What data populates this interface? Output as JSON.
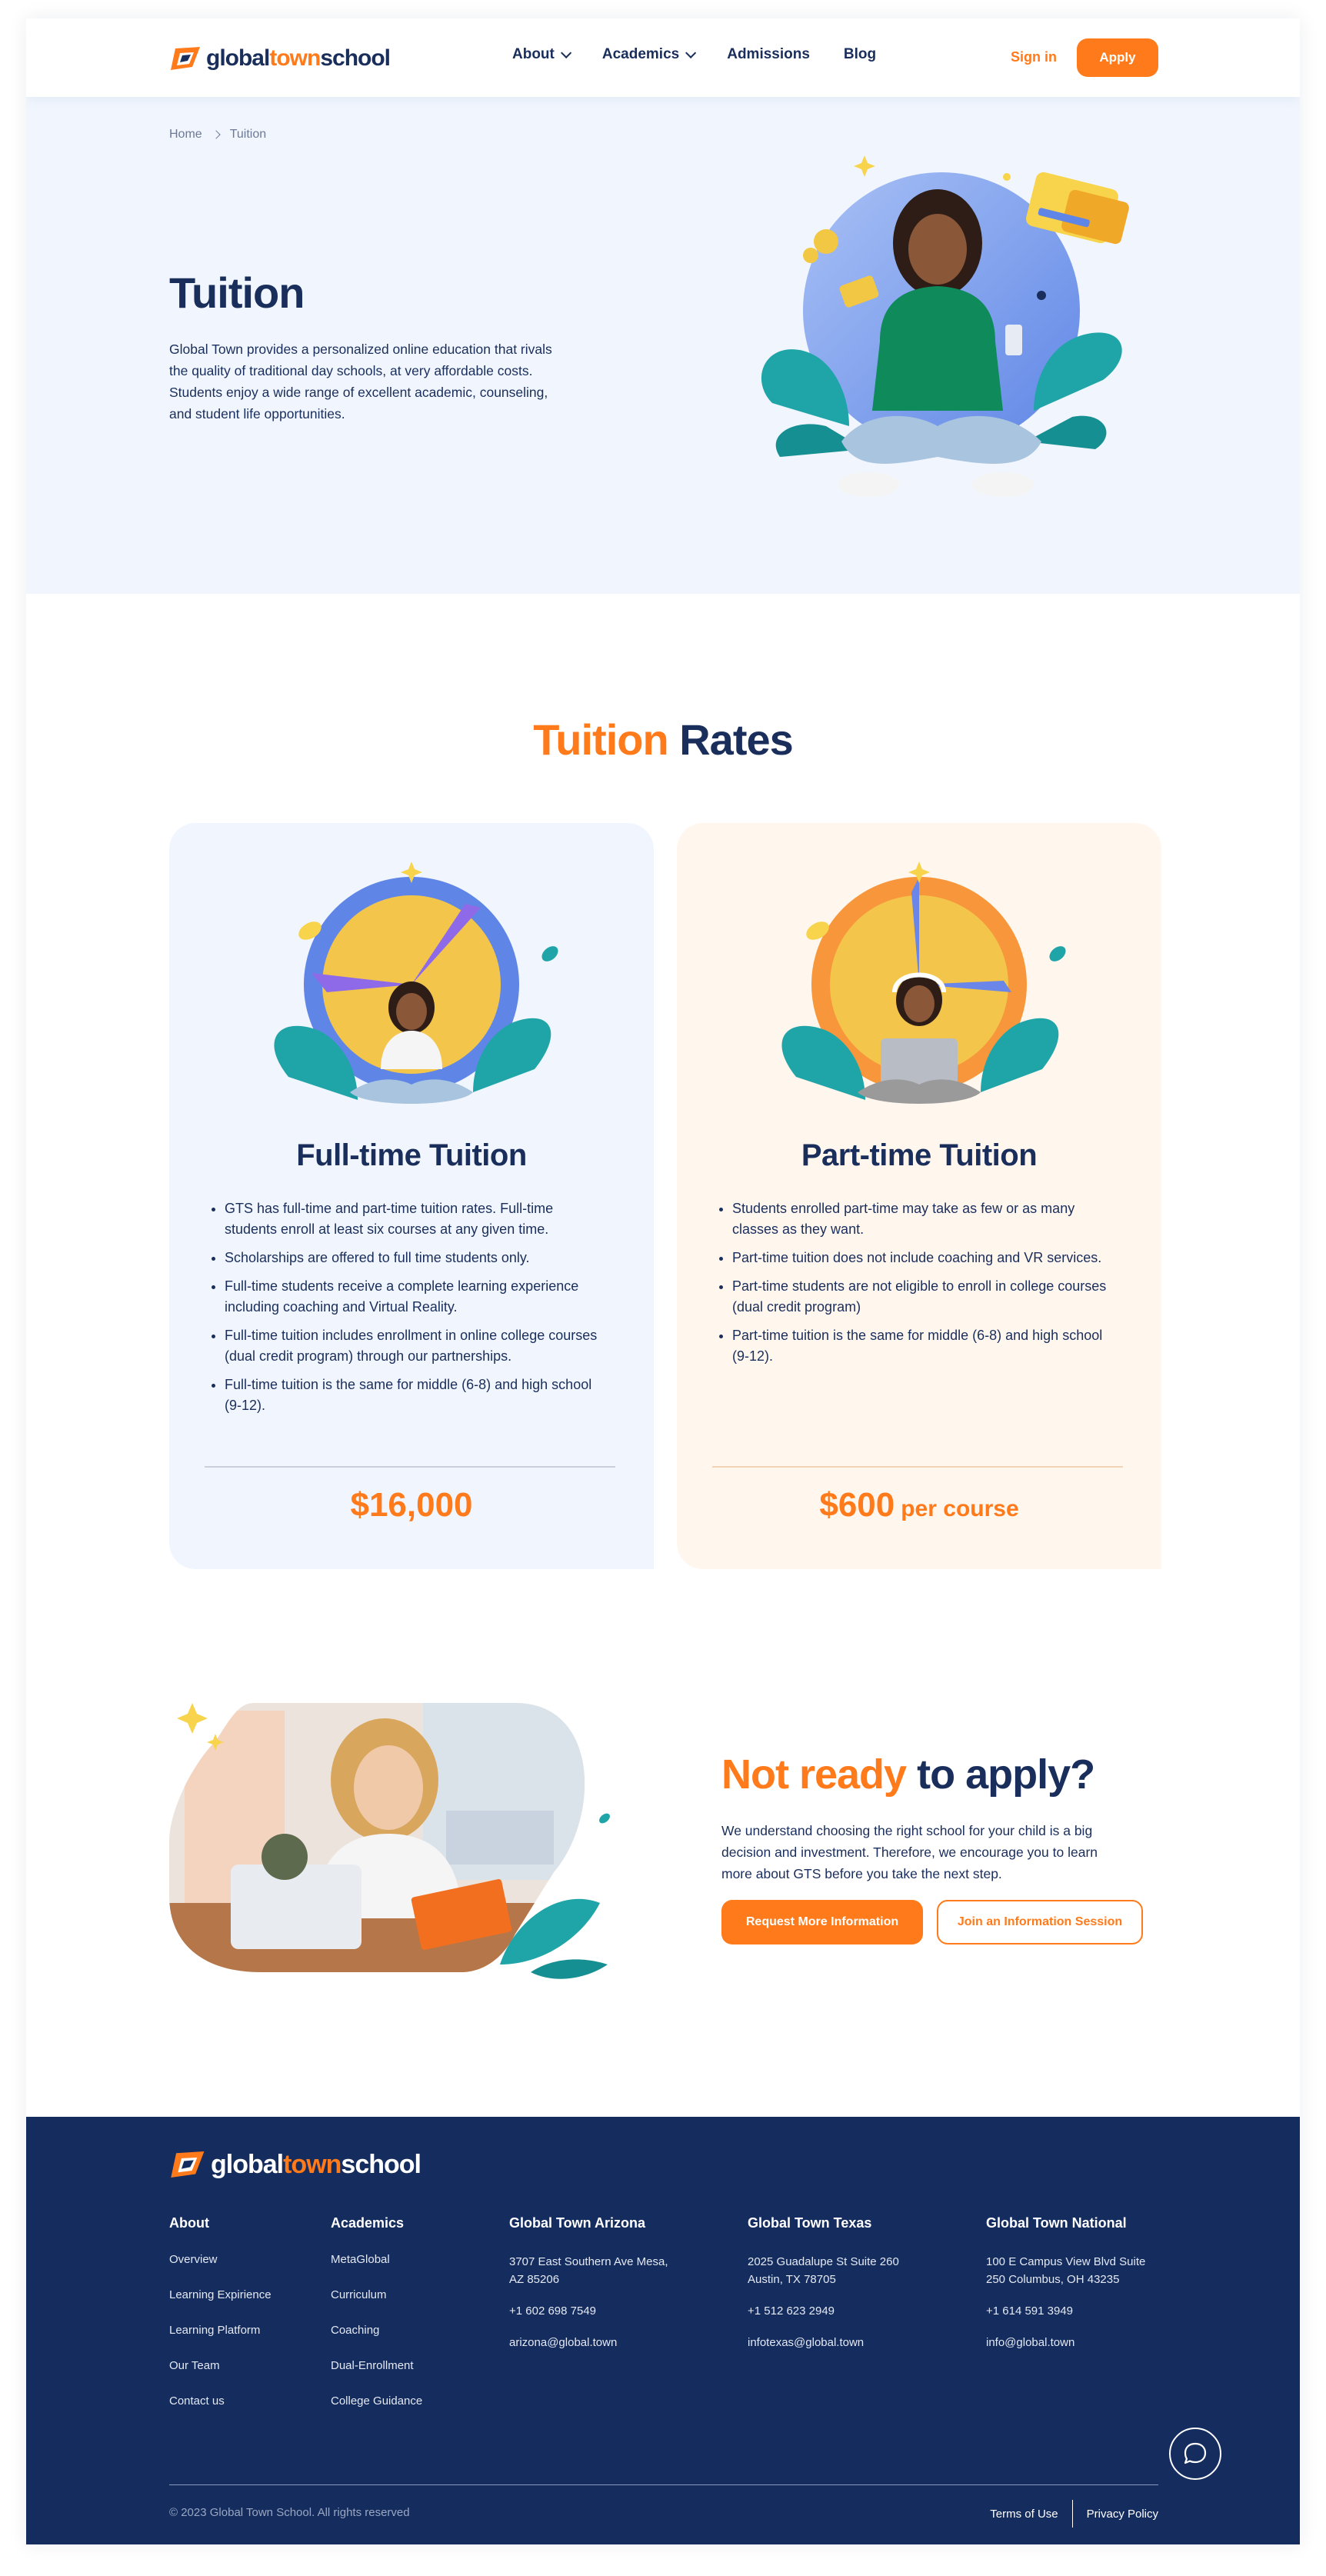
{
  "brand": {
    "logo_part1": "global",
    "logo_part2": "town",
    "logo_part3": "school",
    "accent_color": "#ff7a1a",
    "navy_color": "#1a2e5c"
  },
  "header": {
    "nav": [
      {
        "label": "About",
        "has_dropdown": true
      },
      {
        "label": "Academics",
        "has_dropdown": true
      },
      {
        "label": "Admissions",
        "has_dropdown": false
      },
      {
        "label": "Blog",
        "has_dropdown": false
      }
    ],
    "signin_label": "Sign in",
    "apply_label": "Apply"
  },
  "hero": {
    "breadcrumb": [
      "Home",
      "Tuition"
    ],
    "title": "Tuition",
    "description": "Global Town provides a personalized online education that rivals the quality of traditional day schools, at very affordable costs. Students enjoy a wide range of excellent academic, counseling, and student life opportunities."
  },
  "rates": {
    "title_highlight": "Tuition",
    "title_rest": "Rates",
    "cards": [
      {
        "title": "Full-time Tuition",
        "items": [
          "GTS has full-time and part-time tuition rates. Full-time students enroll at least six courses at any given time.",
          "Scholarships are offered to full time students only.",
          "Full-time students receive a complete learning experience including coaching and Virtual Reality.",
          "Full-time tuition includes enrollment in online college courses (dual credit program) through our partnerships.",
          "Full-time tuition is the same for middle (6-8) and high school (9-12)."
        ],
        "price": "$16,000",
        "unit": ""
      },
      {
        "title": "Part-time Tuition",
        "items": [
          "Students enrolled part-time may take as few or as many classes as they want.",
          "Part-time tuition does not include coaching and VR services.",
          "Part-time students are not eligible to enroll in college courses (dual credit program)",
          "Part-time tuition is the same for middle (6-8) and high school (9-12)."
        ],
        "price": "$600",
        "unit": "per course"
      }
    ]
  },
  "not_ready": {
    "title_highlight": "Not ready",
    "title_rest": "to apply?",
    "description": "We understand choosing the right school for your child is a big decision and investment. Therefore, we encourage you to learn more about GTS before you take the next step.",
    "primary_button": "Request More Information",
    "secondary_button": "Join an Information Session"
  },
  "footer": {
    "about": {
      "heading": "About",
      "links": [
        "Overview",
        "Learning Expirience",
        "Learning Platform",
        "Our Team",
        "Contact us"
      ]
    },
    "academics": {
      "heading": "Academics",
      "links": [
        "MetaGlobal",
        "Curriculum",
        "Coaching",
        "Dual-Enrollment",
        "College Guidance"
      ]
    },
    "arizona": {
      "heading": "Global Town Arizona",
      "address": "3707 East Southern Ave Mesa, AZ 85206",
      "phone": "+1 602 698 7549",
      "email": "arizona@global.town"
    },
    "texas": {
      "heading": "Global Town Texas",
      "address": "2025 Guadalupe St Suite 260 Austin, TX 78705",
      "phone": "+1 512 623 2949",
      "email": "infotexas@global.town"
    },
    "national": {
      "heading": "Global Town National",
      "address": "100 E Campus View Blvd Suite 250 Columbus, OH 43235",
      "phone": "+1 614 591 3949",
      "email": "info@global.town"
    },
    "copyright": "© 2023 Global Town School. All rights reserved",
    "terms": "Terms of Use",
    "privacy": "Privacy Policy"
  }
}
